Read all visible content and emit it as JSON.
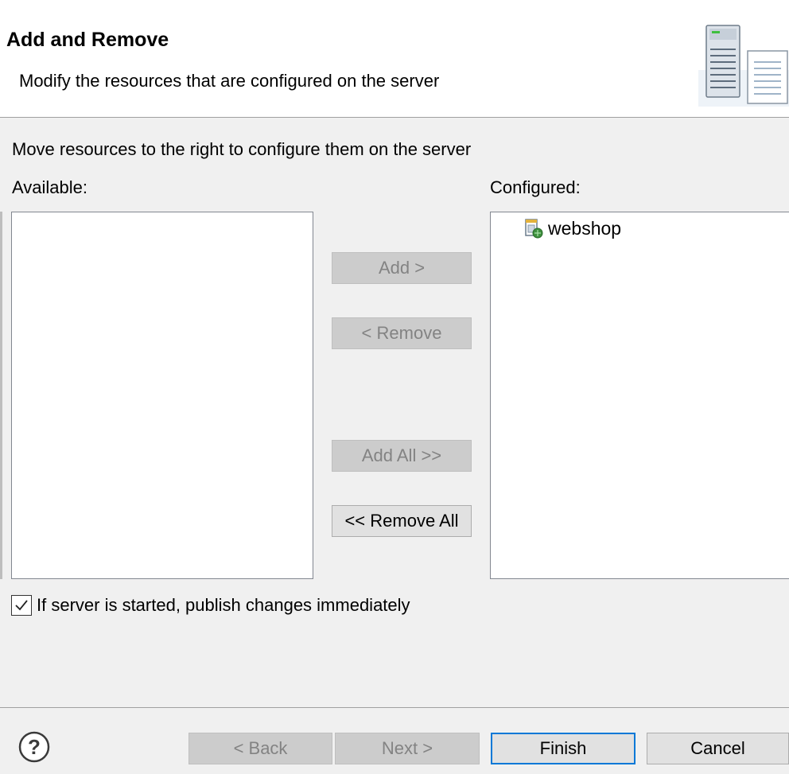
{
  "header": {
    "title": "Add and Remove",
    "description": "Modify the resources that are configured on the server",
    "icon": "server-document-icon"
  },
  "instructions": "Move resources to the right to configure them on the server",
  "available": {
    "label": "Available:",
    "items": []
  },
  "configured": {
    "label": "Configured:",
    "items": [
      {
        "label": "webshop",
        "icon": "web-module-icon"
      }
    ]
  },
  "buttons": {
    "add": "Add >",
    "remove": "< Remove",
    "add_all": "Add All >>",
    "remove_all": "<< Remove All"
  },
  "publish_checkbox": {
    "label": "If server is started, publish changes immediately",
    "checked": true
  },
  "footer": {
    "help_icon": "help-icon",
    "back": "< Back",
    "next": "Next >",
    "finish": "Finish",
    "cancel": "Cancel"
  },
  "colors": {
    "accent": "#0078d7",
    "disabled_text": "#838383",
    "disabled_bg": "#cccccc"
  }
}
